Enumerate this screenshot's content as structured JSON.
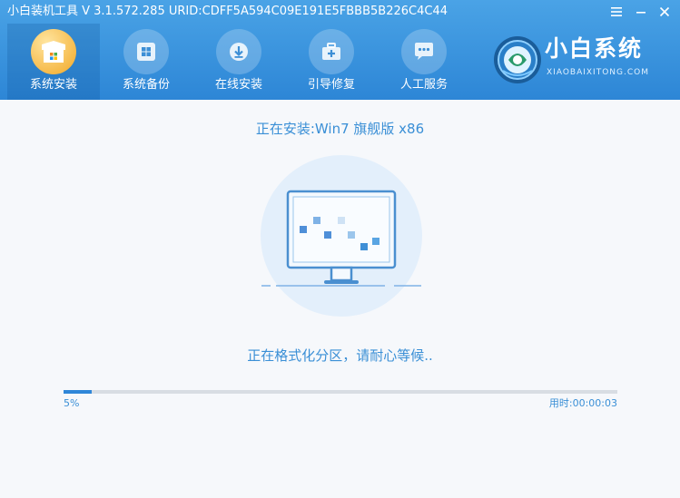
{
  "window": {
    "title": "小白装机工具 V 3.1.572.285 URID:CDFF5A594C09E191E5FBBB5B226C4C44",
    "controls": [
      "menu-icon",
      "minimize-icon",
      "close-icon"
    ]
  },
  "nav": {
    "items": [
      {
        "label": "系统安装",
        "icon": "install-box-icon",
        "active": true
      },
      {
        "label": "系统备份",
        "icon": "backup-windows-icon",
        "active": false
      },
      {
        "label": "在线安装",
        "icon": "download-icon",
        "active": false
      },
      {
        "label": "引导修复",
        "icon": "toolbox-icon",
        "active": false
      },
      {
        "label": "人工服务",
        "icon": "chat-icon",
        "active": false
      }
    ]
  },
  "brand": {
    "name": "小白系统",
    "domain": "XIAOBAIXITONG.COM",
    "logo_icon": "xiaobai-logo-icon"
  },
  "install": {
    "title": "正在安装:Win7 旗舰版 x86",
    "status": "正在格式化分区，请耐心等候..",
    "progress_fraction": 0.05,
    "progress_label": "5%",
    "elapsed": "用时:00:00:03",
    "illustration_icon": "monitor-icon"
  },
  "colors": {
    "header_top": "#4aa3e6",
    "header_bottom": "#2d86d6",
    "accent_text": "#3a8fd6",
    "progress_fill": "#2f86d8",
    "progress_track": "#d8dde3",
    "active_icon": "#f2a825"
  }
}
